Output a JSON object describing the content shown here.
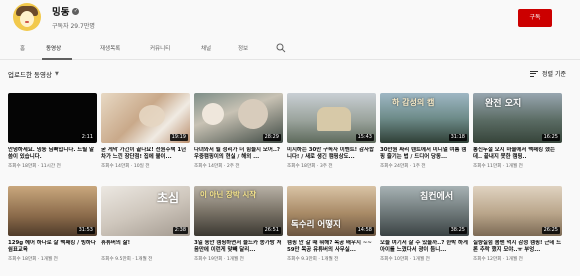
{
  "channel": {
    "name": "밍동",
    "subscribers": "구독자 29.7만명",
    "subscribe_label": "구독"
  },
  "tabs": [
    {
      "label": "홈"
    },
    {
      "label": "동영상",
      "active": true
    },
    {
      "label": "재생목록"
    },
    {
      "label": "커뮤니티"
    },
    {
      "label": "채널"
    },
    {
      "label": "정보"
    }
  ],
  "section": {
    "title": "업로드한 동영상",
    "sort_label": "정렬 기준"
  },
  "videos": [
    {
      "title": "안녕하세요. 밍동 님뻐입니다. 드릴 말씀이 있습니다.",
      "views": "조회수 18만회",
      "age": "11시간 전",
      "duration": "2:11"
    },
    {
      "title": "굳 게막 가긴이 끝나요! 전원주택 1년차가 느낀 장단점! 집에 불이...",
      "views": "조회수 14만회",
      "age": "10일 전",
      "duration": "19:19"
    },
    {
      "title": "다녀와서 될 정리가 더 힘들지 모어..? 우중캠핑이의 현실 / 해외 ...",
      "views": "조회수 14만회",
      "age": "2주 전",
      "duration": "28:29"
    },
    {
      "title": "미지하는 30만 구독자 이벤트! 감사합니다! / 새로 생긴 캠핑상도...",
      "views": "조회수 18만회",
      "age": "3주 전",
      "duration": "15:43"
    },
    {
      "title": "30만원 짜리 텐트에서 미니멀 여름 캠핑 즐기는 법 / 드디어 당동...",
      "views": "조회수 24만회",
      "age": "1주 전",
      "duration": "31:18"
    },
    {
      "title": "통신두절 오지 마을에서 백패킹 했는데.. 끝내지 못한 캠핑..",
      "views": "조회수 11만회",
      "age": "1개월 전",
      "duration": "16:25"
    },
    {
      "title": "129g 헤어 하나로 살 백패킹 / 빙하다 쉼표교육",
      "views": "조회수 18만회",
      "age": "1개월 전",
      "duration": "31:53"
    },
    {
      "title": "휴튜버의 삶!",
      "views": "조회수 9.5만회",
      "age": "1개월 전",
      "duration": "2:38"
    },
    {
      "title": "3일 동안 캠핑하면서 물드카 쫑가방 처음만에 이런게 맞빼 달리...",
      "views": "조회수 19만회",
      "age": "1개월 전",
      "duration": "26:51"
    },
    {
      "title": "캠핑 안 갈 때 뭐해? 목공 배우지 ~~ 59만 목공 유튜버의 사무실...",
      "views": "조회수 9.3만회",
      "age": "1개월 전",
      "duration": "14:58"
    },
    {
      "title": "오늘 여기서 잘 수 있을까..? 한박 하게 아이를 느꼈다서 광이 듬니...",
      "views": "조회수 10만회",
      "age": "1개월 전",
      "duration": "38:25"
    },
    {
      "title": "실량실험 봄맨 먹지 감성 캠핑! 근데 드론 추락 했지 모야..ㅠ 부엉...",
      "views": "조회수 12만회",
      "age": "1개월 전",
      "duration": "26:25"
    }
  ],
  "thumbnail_overlays": {
    "v5": "하 감성의 캠",
    "v6": "완전 오지",
    "v8": "초심",
    "v9": "이 아닌 장박 시작",
    "v10": "독수리 어떻지",
    "v11": "침컨에서"
  },
  "colors": {
    "accent_red": "#cc0000",
    "text_primary": "#0f0f0f",
    "text_secondary": "#606060"
  }
}
